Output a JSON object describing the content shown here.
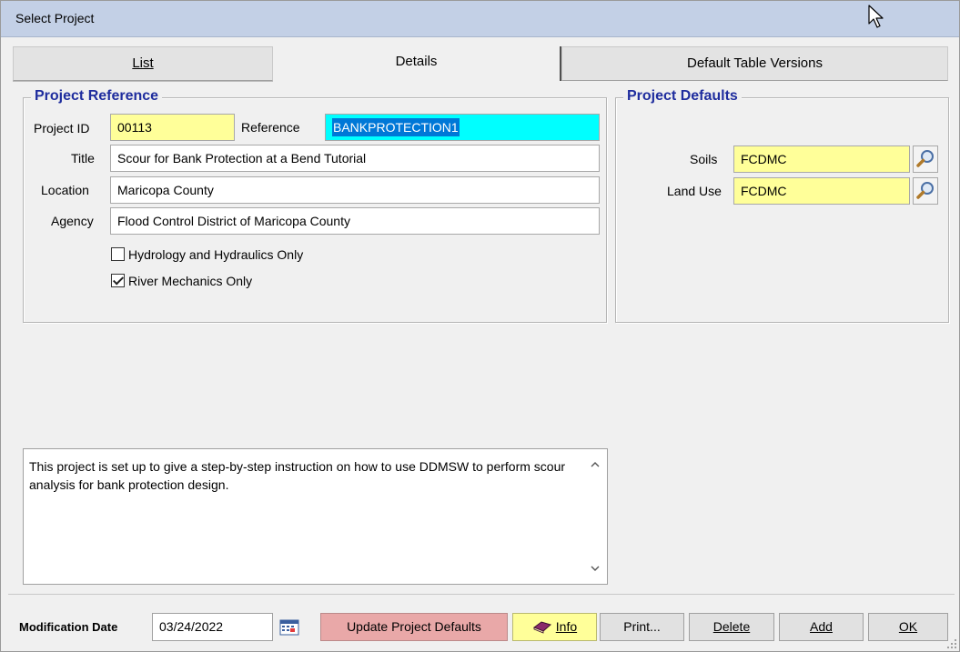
{
  "window": {
    "title": "Select Project"
  },
  "tabs": {
    "list": "List",
    "details": "Details",
    "default_table_versions": "Default Table Versions",
    "active": "Details"
  },
  "project_reference": {
    "legend": "Project Reference",
    "project_id_label": "Project ID",
    "project_id": "00113",
    "reference_label": "Reference",
    "reference": "BANKPROTECTION1",
    "title_label": "Title",
    "title": "Scour for Bank Protection at a Bend Tutorial",
    "location_label": "Location",
    "location": "Maricopa County",
    "agency_label": "Agency",
    "agency": "Flood Control District of Maricopa County",
    "hydrology_label": "Hydrology and Hydraulics Only",
    "hydrology_checked": false,
    "river_mechanics_label": "River Mechanics Only",
    "river_mechanics_checked": true
  },
  "project_defaults": {
    "legend": "Project Defaults",
    "soils_label": "Soils",
    "soils": "FCDMC",
    "land_use_label": "Land Use",
    "land_use": "FCDMC"
  },
  "notes": {
    "text": "This project is set up to give a step-by-step instruction on how to use DDMSW to perform scour analysis for bank protection design."
  },
  "footer": {
    "modification_date_label": "Modification Date",
    "modification_date": "03/24/2022",
    "update_defaults_button": "Update Project Defaults",
    "info_button": "Info",
    "print_button": "Print...",
    "delete_button": "Delete",
    "add_button": "Add",
    "ok_button": "OK"
  },
  "colors": {
    "title_bar": "#c3d0e6",
    "legend_text": "#1f2d9e",
    "required_field": "#ffff99",
    "reference_field": "#00ffff",
    "selection": "#0078d7",
    "update_button": "#e9a8a8"
  },
  "icons": [
    "mouse-cursor-icon",
    "magnifier-icon",
    "calendar-icon",
    "info-book-icon",
    "scroll-up-icon",
    "scroll-down-icon",
    "resize-grip-icon"
  ]
}
